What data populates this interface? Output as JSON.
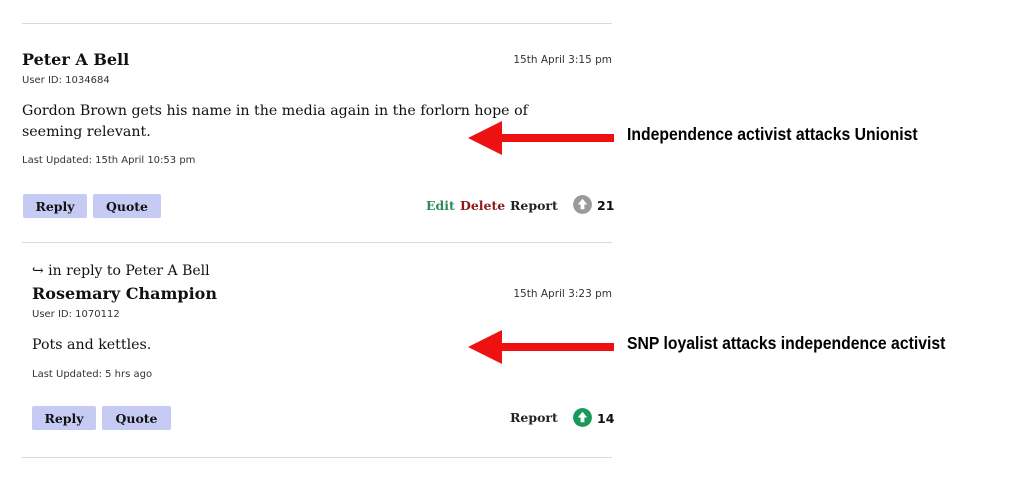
{
  "comments": [
    {
      "author": "Peter A Bell",
      "timestamp": "15th April 3:15 pm",
      "user_id": "User ID: 1034684",
      "body": "Gordon Brown gets his name in the media again in the forlorn hope of seeming relevant.",
      "last_updated": "Last Updated: 15th April 10:53 pm",
      "reply_label": "Reply",
      "quote_label": "Quote",
      "edit_label": "Edit",
      "delete_label": "Delete",
      "report_label": "Report",
      "votes": "21"
    },
    {
      "in_reply_to": "↪ in reply to Peter A Bell",
      "author": "Rosemary Champion",
      "timestamp": "15th April 3:23 pm",
      "user_id": "User ID: 1070112",
      "body": "Pots and kettles.",
      "last_updated": "Last Updated: 5 hrs ago",
      "reply_label": "Reply",
      "quote_label": "Quote",
      "report_label": "Report",
      "votes": "14"
    }
  ],
  "annotations": [
    "Independence activist attacks Unionist",
    "SNP loyalist attacks independence activist"
  ],
  "colors": {
    "edit": "#2e8b57",
    "delete": "#8b1a1a",
    "vote_grey": "#9a9a9a",
    "vote_green": "#1a9a5a",
    "arrow_red": "#ee1111",
    "button_bg": "#c5cbf2"
  },
  "icons": {
    "vote": "up-arrow-circle-icon",
    "reply_indicator": "reply-arrow-icon",
    "annotation_arrow": "left-arrow-icon"
  }
}
